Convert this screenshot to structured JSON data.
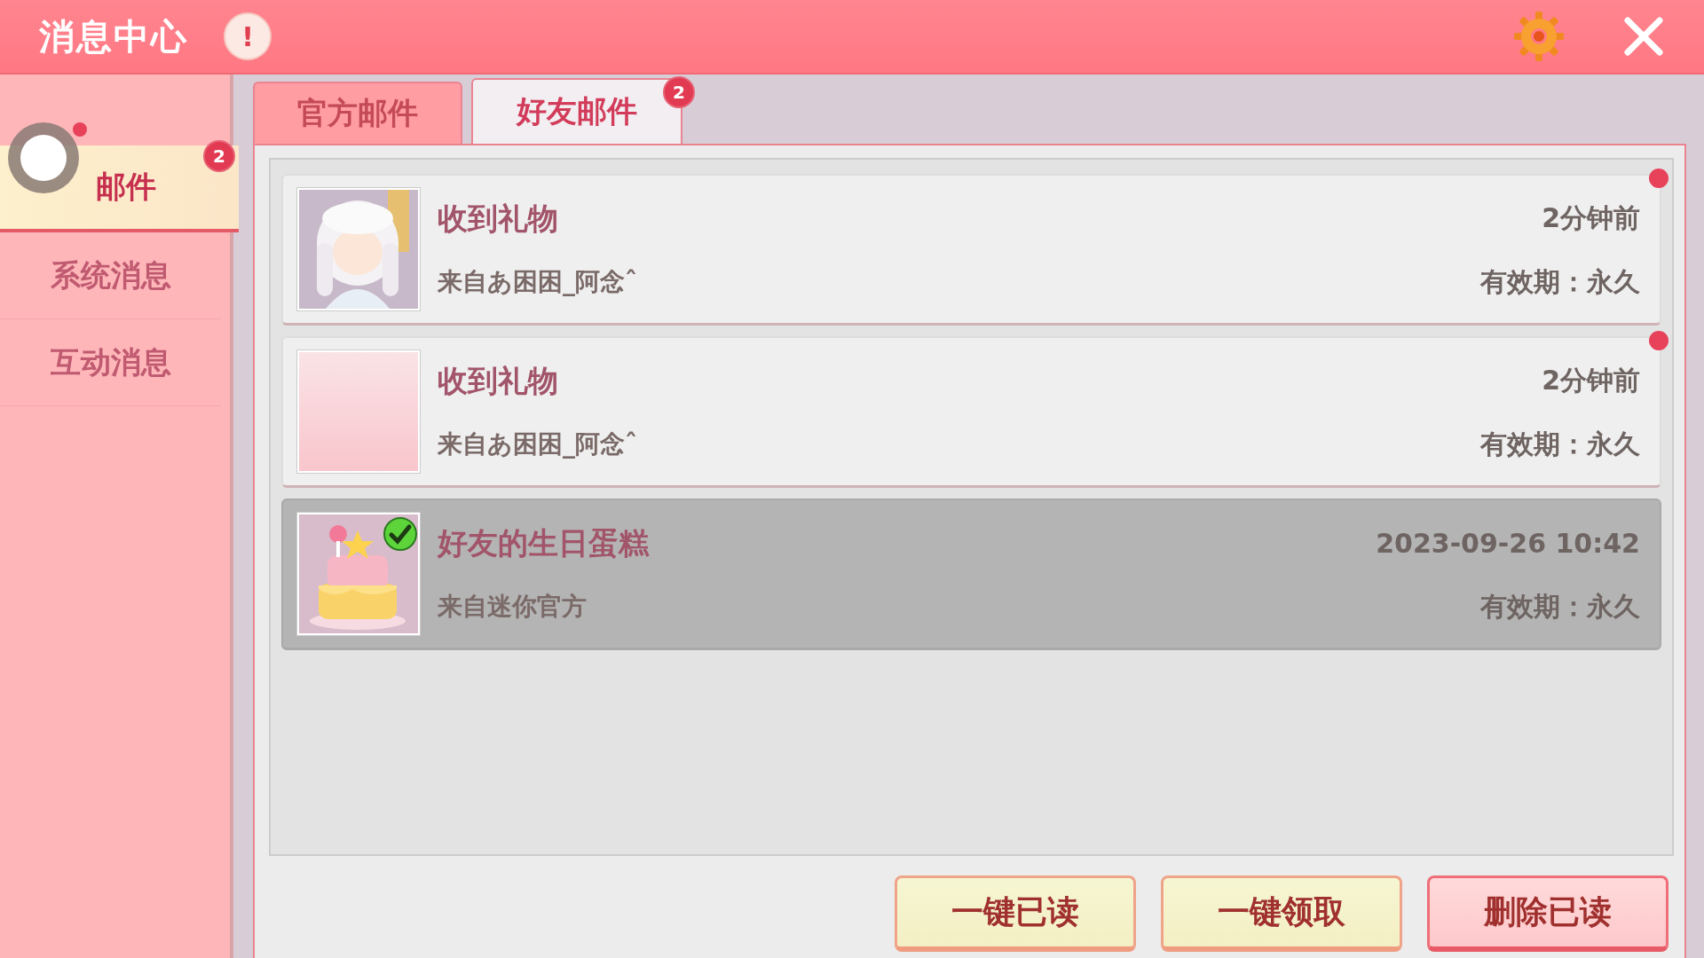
{
  "window": {
    "title": "消息中心",
    "alert_mark": "!"
  },
  "sidebar": {
    "items": [
      {
        "label": "邮件",
        "selected": true,
        "badge": "2"
      },
      {
        "label": "系统消息",
        "selected": false
      },
      {
        "label": "互动消息",
        "selected": false
      }
    ]
  },
  "tabs": [
    {
      "label": "官方邮件",
      "selected": false
    },
    {
      "label": "好友邮件",
      "selected": true,
      "badge": "2"
    }
  ],
  "mails": [
    {
      "kind": "portrait",
      "title": "收到礼物",
      "sender": "来自あ困困_阿念ˆ",
      "time": "2分钟前",
      "validity": "有效期：永久",
      "unread": true,
      "claimed": false
    },
    {
      "kind": "blank",
      "title": "收到礼物",
      "sender": "来自あ困困_阿念ˆ",
      "time": "2分钟前",
      "validity": "有效期：永久",
      "unread": true,
      "claimed": false
    },
    {
      "kind": "cake",
      "title": "好友的生日蛋糕",
      "sender": "来自迷你官方",
      "time": "2023-09-26 10:42",
      "validity": "有效期：永久",
      "unread": false,
      "claimed": true
    }
  ],
  "buttons": [
    {
      "label": "一键已读",
      "kind": "cream"
    },
    {
      "label": "一键领取",
      "kind": "cream"
    },
    {
      "label": "删除已读",
      "kind": "pink"
    }
  ]
}
